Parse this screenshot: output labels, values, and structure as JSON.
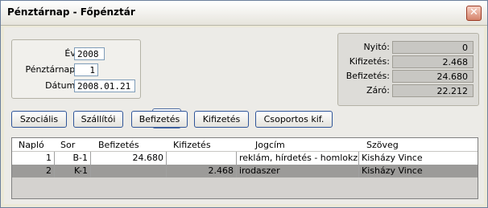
{
  "window": {
    "title": "Pénztárnap - Főpénztár"
  },
  "form": {
    "ev_label": "Év:",
    "ev_value": "2008",
    "penztarnap_label": "Pénztárnap:",
    "penztarnap_value": "1",
    "datum_label": "Dátum:",
    "datum_value": "2008.01.21"
  },
  "summary": {
    "nyito_label": "Nyitó:",
    "nyito_value": "0",
    "kifizetes_label": "Kifizetés:",
    "kifizetes_value": "2.468",
    "befizetes_label": "Befizetés:",
    "befizetes_value": "24.680",
    "zaro_label": "Záró:",
    "zaro_value": "22.212"
  },
  "buttons": {
    "szocialis": "Szociális",
    "szallitoi": "Szállítói",
    "befizetes": "Befizetés",
    "kifizetes": "Kifizetés",
    "csoportos": "Csoportos kif."
  },
  "table": {
    "headers": [
      "Napló",
      "Sor",
      "Befizetés",
      "Kifizetés",
      "Jogcím",
      "Szöveg"
    ],
    "rows": [
      {
        "naplo": "1",
        "sor": "B-1",
        "befizetes": "24.680",
        "kifizetes": "",
        "jogcim": "reklám, hírdetés - homlokzati",
        "szoveg": "Kisházy Vince"
      },
      {
        "naplo": "2",
        "sor": "K-1",
        "befizetes": "",
        "kifizetes": "2.468",
        "jogcim": "irodaszer",
        "szoveg": "Kisházy Vince"
      }
    ]
  },
  "colors": {
    "selected_row": "#9c9b99",
    "titlebar": "#f2f1ec",
    "close": "#d4826a"
  },
  "icons": {
    "close": "close-icon",
    "save": "floppy-disk-icon"
  }
}
